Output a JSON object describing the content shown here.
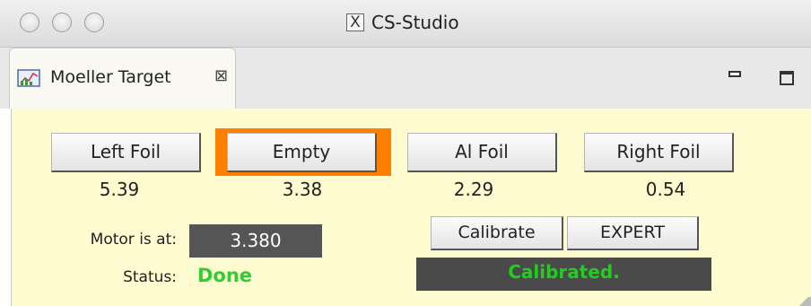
{
  "window": {
    "title": "CS-Studio",
    "x_icon": "X"
  },
  "tab": {
    "label": "Moeller Target",
    "close_icon": "⊠"
  },
  "targets": [
    {
      "label": "Left Foil",
      "value": "5.39"
    },
    {
      "label": "Empty",
      "value": "3.38"
    },
    {
      "label": "Al Foil",
      "value": "2.29"
    },
    {
      "label": "Right Foil",
      "value": "0.54"
    }
  ],
  "selected_target": "Empty",
  "colors": {
    "panel_bg": "#fffbd0",
    "selected_highlight": "#ff8000",
    "status_green": "#33cc33"
  },
  "motor": {
    "label": "Motor is at:",
    "position": "3.380"
  },
  "status": {
    "label": "Status:",
    "value": "Done"
  },
  "controls": {
    "calibrate_label": "Calibrate",
    "expert_label": "EXPERT",
    "calibration_status": "Calibrated."
  }
}
